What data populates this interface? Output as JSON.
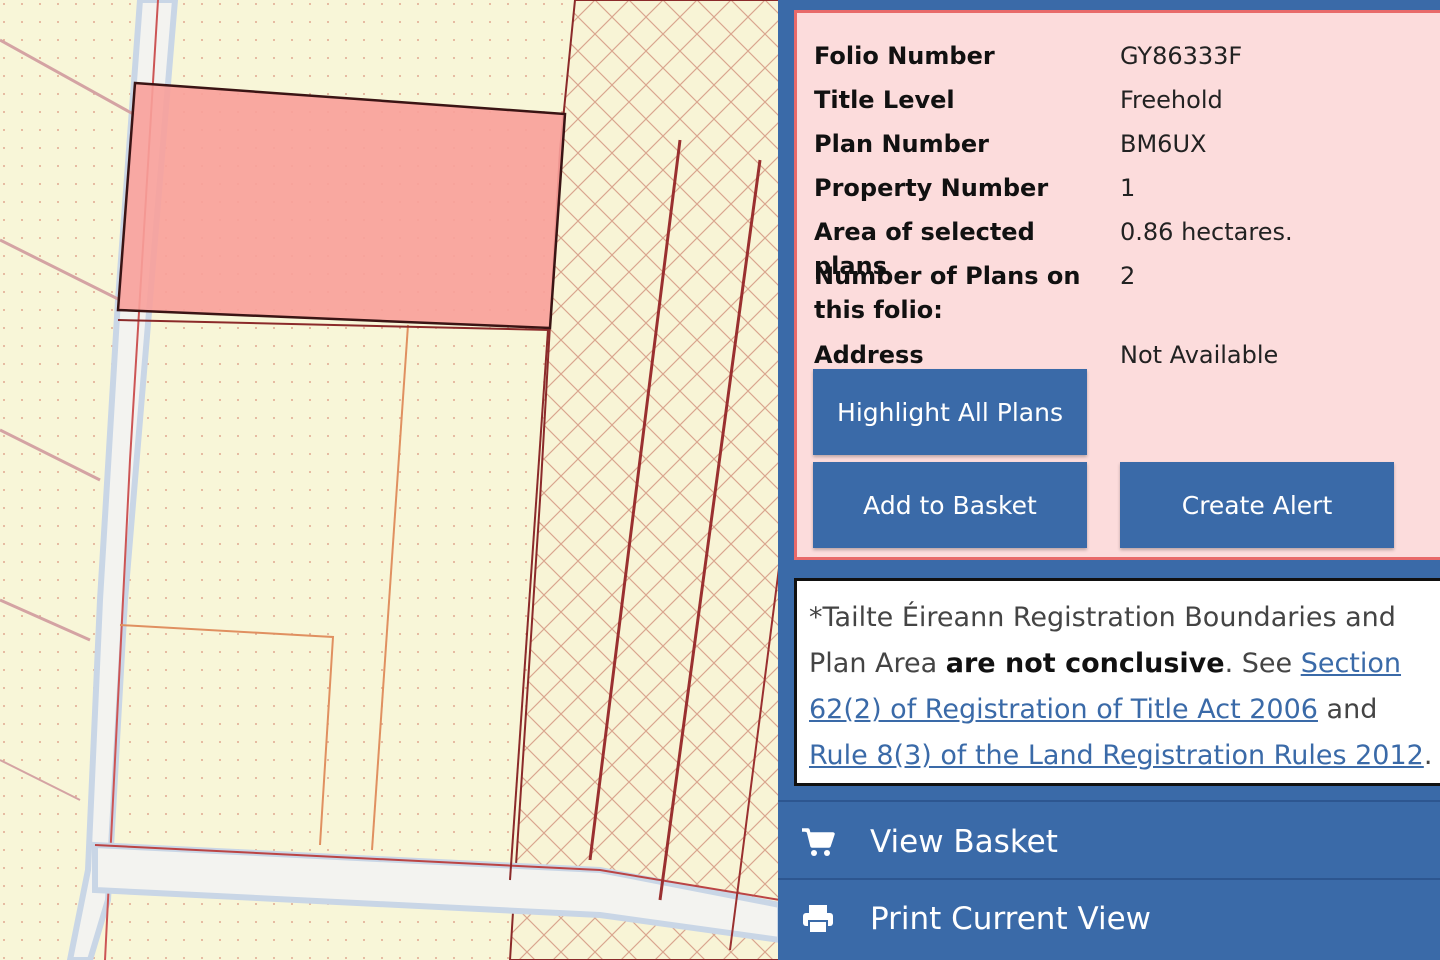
{
  "folio": {
    "fields": [
      {
        "label": "Folio Number",
        "value": "GY86333F"
      },
      {
        "label": "Title Level",
        "value": "Freehold"
      },
      {
        "label": "Plan Number",
        "value": "BM6UX"
      },
      {
        "label": "Property Number",
        "value": "1"
      },
      {
        "label": "Area of selected plans",
        "value": "0.86 hectares."
      },
      {
        "label_line1": "Number of Plans on",
        "label_line2": "this folio:",
        "value": "2"
      },
      {
        "label": "Address",
        "value": "Not Available"
      }
    ],
    "buttons": {
      "highlight": "Highlight All Plans",
      "basket": "Add to Basket",
      "alert": "Create Alert"
    }
  },
  "notice": {
    "text1": "*Tailte Éireann Registration Boundaries and Plan Area ",
    "bold": "are not conclusive",
    "text2": ". See ",
    "link1": "Section 62(2) of Registration of Title Act 2006",
    "text3": " and ",
    "link2": "Rule 8(3) of the Land Registration Rules 2012",
    "text4": "."
  },
  "menu": {
    "view_basket": "View Basket",
    "print_view": "Print Current View"
  },
  "icons": {
    "basket": "shopping-cart-icon",
    "print": "printer-icon"
  },
  "colors": {
    "panel_blue": "#3a6aa8",
    "info_bg": "#fcdcdc",
    "info_border": "#e86a6a",
    "selected_parcel": "#f8a09a",
    "map_bg": "#f8f6d8"
  }
}
